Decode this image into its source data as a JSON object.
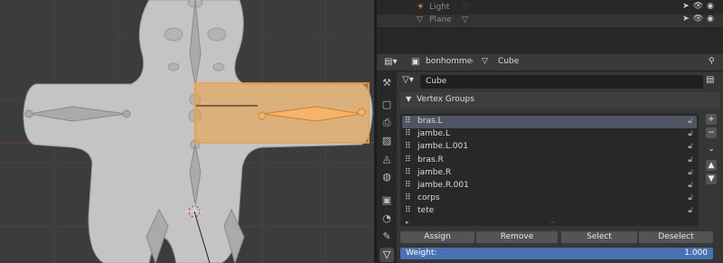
{
  "outliner": {
    "rows": [
      {
        "label": "Light"
      },
      {
        "label": "Plane"
      }
    ]
  },
  "header": {
    "object_name": "bonhomme",
    "mesh_name": "Cube"
  },
  "mesh_data_field": {
    "value": "Cube"
  },
  "vertex_groups": {
    "title": "Vertex Groups",
    "items": [
      {
        "label": "bras.L",
        "selected": true
      },
      {
        "label": "jambe.L",
        "selected": false
      },
      {
        "label": "jambe.L.001",
        "selected": false
      },
      {
        "label": "bras.R",
        "selected": false
      },
      {
        "label": "jambe.R",
        "selected": false
      },
      {
        "label": "jambe.R.001",
        "selected": false
      },
      {
        "label": "corps",
        "selected": false
      },
      {
        "label": "tete",
        "selected": false
      }
    ],
    "buttons": {
      "assign": "Assign",
      "remove": "Remove",
      "select": "Select",
      "deselect": "Deselect"
    },
    "weight": {
      "label": "Weight:",
      "value": "1.000"
    }
  },
  "colors": {
    "selection_orange": "#f0a040",
    "slider_blue": "#4772b3",
    "selected_row": "#4f5562"
  }
}
